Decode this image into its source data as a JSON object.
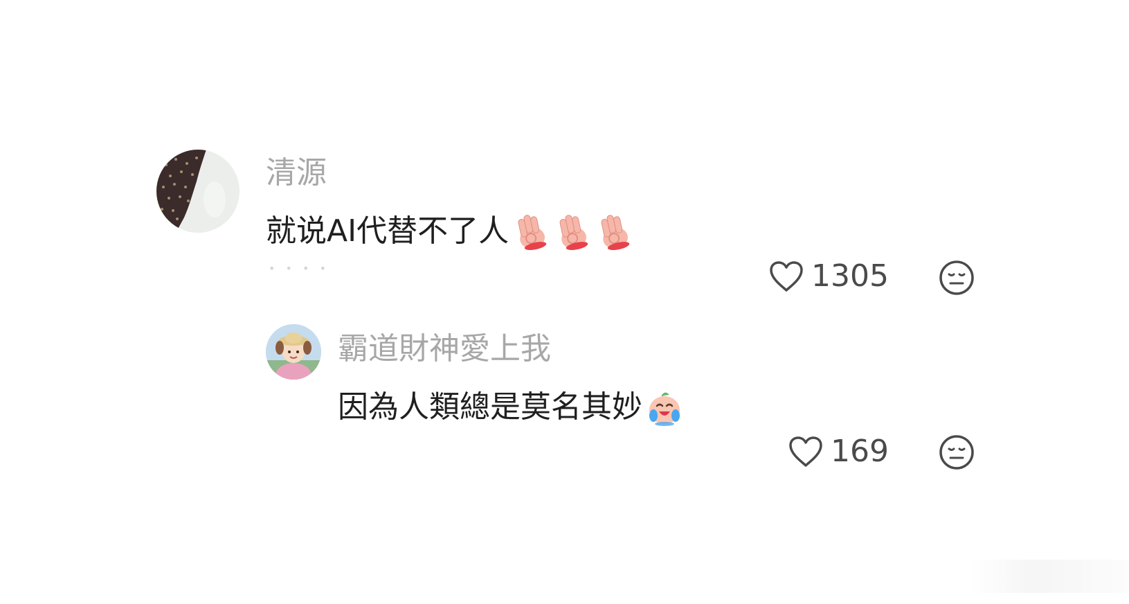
{
  "comments": [
    {
      "username": "清源",
      "text": "就说AI代替不了人",
      "emojis": [
        "ok-hand-icon",
        "ok-hand-icon",
        "ok-hand-icon"
      ],
      "likes": "1305",
      "avatar": "dark-speckled-avatar"
    }
  ],
  "replies": [
    {
      "username": "霸道財神愛上我",
      "text": "因為人類總是莫名其妙",
      "emojis": [
        "crying-laughing-face-icon"
      ],
      "likes": "169",
      "avatar": "cartoon-girl-avatar"
    }
  ],
  "colors": {
    "username": "#a7a7a7",
    "text": "#1f1f1f",
    "icon": "#4a4a4a",
    "background": "#ffffff"
  }
}
